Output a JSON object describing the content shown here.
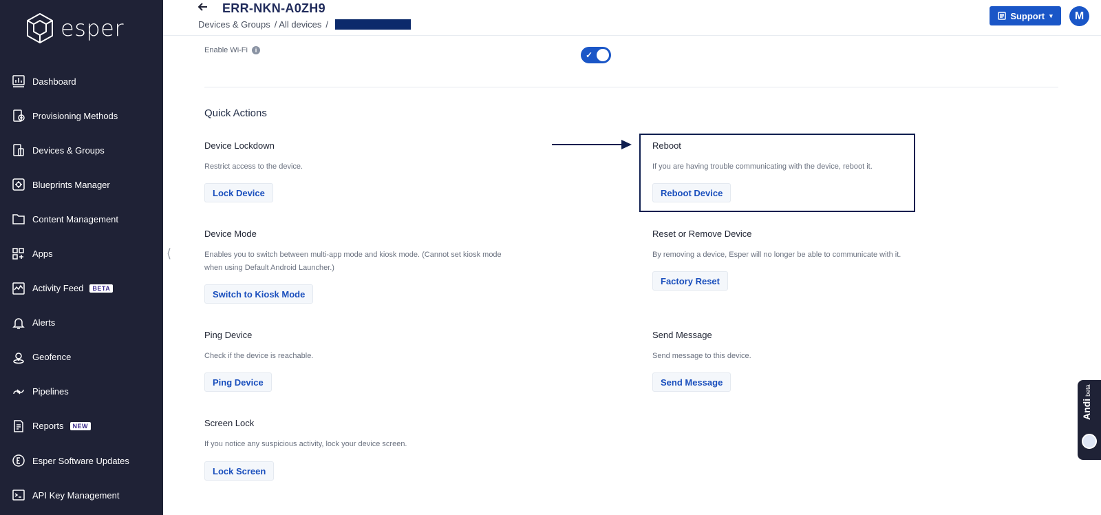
{
  "brand": {
    "name": "esper"
  },
  "sidebar": {
    "items": [
      {
        "label": "Dashboard",
        "icon": "dashboard-icon"
      },
      {
        "label": "Provisioning Methods",
        "icon": "provisioning-icon"
      },
      {
        "label": "Devices & Groups",
        "icon": "devices-icon"
      },
      {
        "label": "Blueprints Manager",
        "icon": "blueprints-icon"
      },
      {
        "label": "Content Management",
        "icon": "folder-icon"
      },
      {
        "label": "Apps",
        "icon": "apps-icon"
      },
      {
        "label": "Activity Feed",
        "icon": "activity-icon",
        "badge": "BETA"
      },
      {
        "label": "Alerts",
        "icon": "bell-icon"
      },
      {
        "label": "Geofence",
        "icon": "geofence-icon"
      },
      {
        "label": "Pipelines",
        "icon": "pipelines-icon"
      },
      {
        "label": "Reports",
        "icon": "reports-icon",
        "badge": "NEW"
      },
      {
        "label": "Esper Software Updates",
        "icon": "updates-icon"
      },
      {
        "label": "API Key Management",
        "icon": "terminal-icon"
      }
    ]
  },
  "header": {
    "title": "ERR-NKN-A0ZH9",
    "breadcrumb": [
      "Devices & Groups",
      "/ All devices",
      "/"
    ],
    "support_label": "Support",
    "avatar_initial": "M"
  },
  "wifi": {
    "label": "Enable Wi-Fi",
    "info": "i",
    "enabled": true
  },
  "quick_actions": {
    "title": "Quick Actions",
    "lockdown": {
      "title": "Device Lockdown",
      "desc": "Restrict access to the device.",
      "button": "Lock Device"
    },
    "reboot": {
      "title": "Reboot",
      "desc": "If you are having trouble communicating with the device, reboot it.",
      "button": "Reboot Device"
    },
    "mode": {
      "title": "Device Mode",
      "desc": "Enables you to switch between multi-app mode and kiosk mode. (Cannot set kiosk mode when using Default Android Launcher.)",
      "button": "Switch to Kiosk Mode"
    },
    "reset": {
      "title": "Reset or Remove Device",
      "desc": "By removing a device, Esper will no longer be able to communicate with it.",
      "button": "Factory Reset"
    },
    "ping": {
      "title": "Ping Device",
      "desc": "Check if the device is reachable.",
      "button": "Ping Device"
    },
    "message": {
      "title": "Send Message",
      "desc": "Send message to this device.",
      "button": "Send Message"
    },
    "screen_lock": {
      "title": "Screen Lock",
      "desc": "If you notice any suspicious activity, lock your device screen.",
      "button": "Lock Screen"
    }
  },
  "andi": {
    "label": "Andi",
    "tag": "beta"
  },
  "colors": {
    "sidebar": "#1f2236",
    "accent": "#1a56c7",
    "highlight_border": "#0e1e4f"
  }
}
